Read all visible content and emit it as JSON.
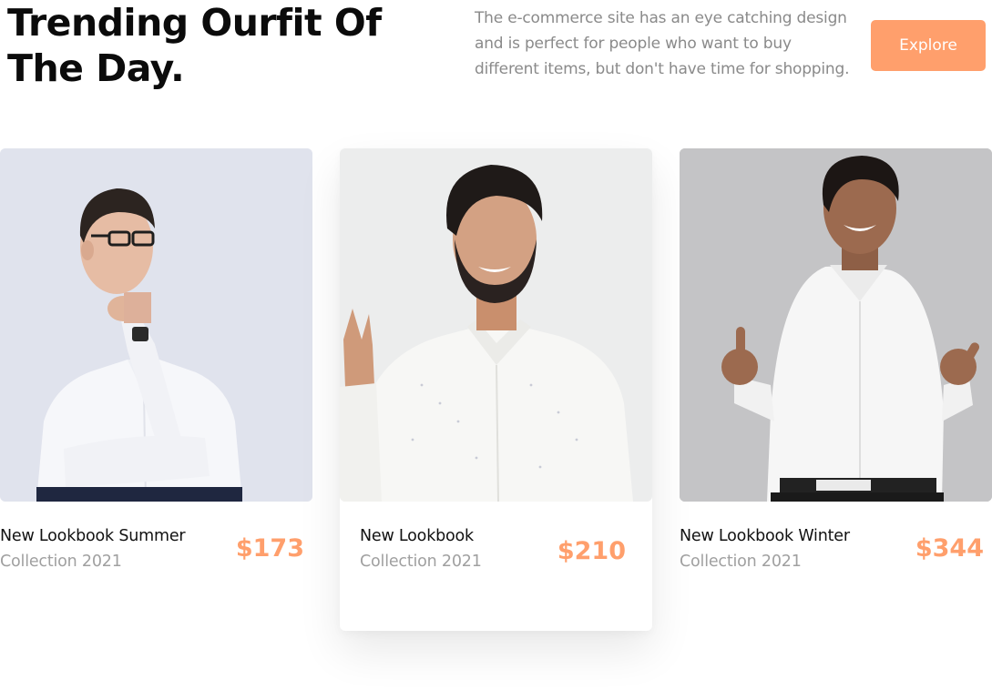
{
  "header": {
    "title_line1": "Trending Ourfit Of",
    "title_line2": "The Day.",
    "description": "The e-commerce site has an eye catching design and is perfect for people who want to buy different items, but don't have time for shopping.",
    "explore_label": "Explore"
  },
  "products": [
    {
      "title": "New Lookbook Summer",
      "subtitle": "Collection 2021",
      "price": "$173"
    },
    {
      "title": "New Lookbook",
      "subtitle": "Collection 2021",
      "price": "$210"
    },
    {
      "title": "New Lookbook Winter",
      "subtitle": "Collection 2021",
      "price": "$344"
    }
  ],
  "colors": {
    "accent": "#ff9f6c",
    "heading": "#0b0b0b",
    "muted": "#8a8a8a"
  }
}
